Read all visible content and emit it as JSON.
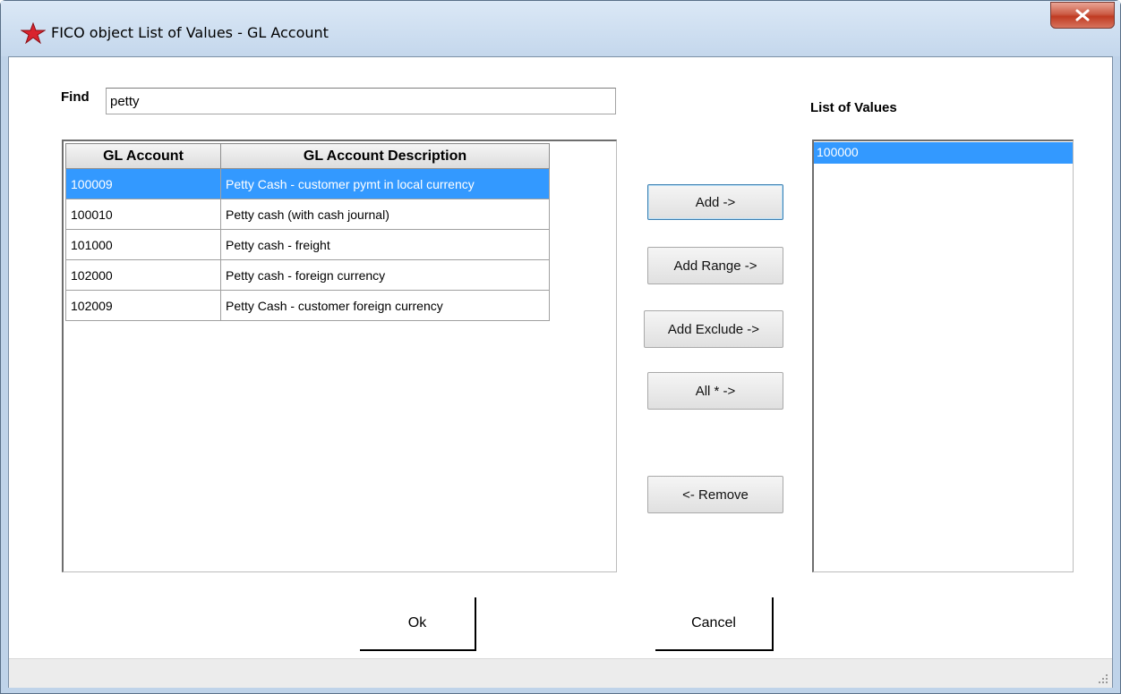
{
  "window": {
    "title": "FICO object List of Values - GL Account",
    "close_symbol": "X",
    "icon": "star-icon"
  },
  "find": {
    "label": "Find",
    "value": "petty"
  },
  "grid": {
    "columns": [
      "GL Account",
      "GL Account Description"
    ],
    "rows": [
      {
        "account": "100009",
        "description": "Petty Cash - customer pymt in local currency",
        "selected": true
      },
      {
        "account": "100010",
        "description": "Petty cash (with cash journal)",
        "selected": false
      },
      {
        "account": "101000",
        "description": "Petty cash - freight",
        "selected": false
      },
      {
        "account": "102000",
        "description": "Petty cash - foreign currency",
        "selected": false
      },
      {
        "account": "102009",
        "description": "Petty Cash - customer foreign currency",
        "selected": false
      }
    ]
  },
  "actions": {
    "add": "Add ->",
    "add_range": "Add Range ->",
    "add_exclude": "Add Exclude ->",
    "all": "All * ->",
    "remove": "<- Remove"
  },
  "list_of_values": {
    "label": "List of Values",
    "items": [
      "100000"
    ]
  },
  "footer": {
    "ok": "Ok",
    "cancel": "Cancel"
  },
  "colors": {
    "selection": "#3399ff",
    "title_bar": "#c4d7ec",
    "close_button": "#c03b22"
  }
}
